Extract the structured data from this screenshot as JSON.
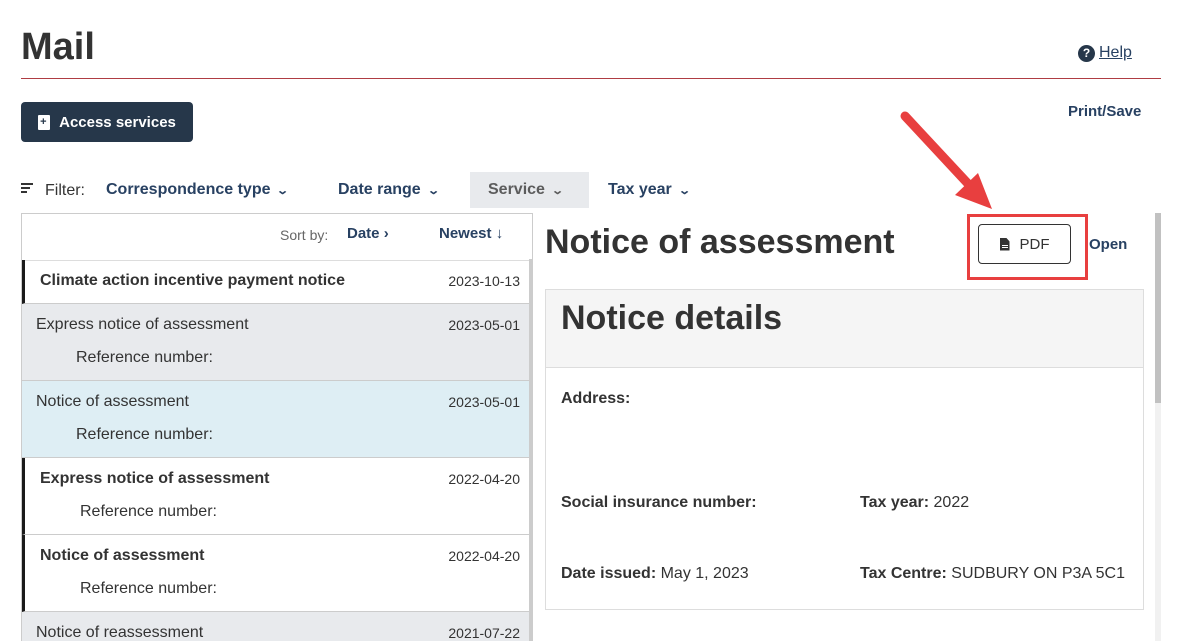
{
  "header": {
    "title": "Mail",
    "help_label": "Help",
    "access_label": "Access services",
    "print_label": "Print/Save"
  },
  "filter": {
    "label": "Filter:",
    "options": [
      "Correspondence type",
      "Date range",
      "Service",
      "Tax year"
    ],
    "active": "Service"
  },
  "sort": {
    "label": "Sort by:",
    "field": "Date",
    "order": "Newest"
  },
  "mail_list": [
    {
      "name": "Climate action incentive payment notice",
      "date": "2023-10-13",
      "ref_label": "",
      "unread": true,
      "state": "normal"
    },
    {
      "name": "Express notice of assessment",
      "date": "2023-05-01",
      "ref_label": "Reference number:",
      "unread": false,
      "state": "grey"
    },
    {
      "name": "Notice of assessment",
      "date": "2023-05-01",
      "ref_label": "Reference number:",
      "unread": false,
      "state": "selected"
    },
    {
      "name": "Express notice of assessment",
      "date": "2022-04-20",
      "ref_label": "Reference number:",
      "unread": true,
      "state": "normal"
    },
    {
      "name": "Notice of assessment",
      "date": "2022-04-20",
      "ref_label": "Reference number:",
      "unread": true,
      "state": "normal"
    },
    {
      "name": "Notice of reassessment",
      "date": "2021-07-22",
      "ref_label": "",
      "unread": false,
      "state": "grey"
    }
  ],
  "detail": {
    "title": "Notice of assessment",
    "pdf_label": "PDF",
    "open_label": "Open",
    "details_heading": "Notice details",
    "address_label": "Address:",
    "sin_label": "Social insurance number:",
    "tax_year_label": "Tax year:",
    "tax_year_value": "2022",
    "date_issued_label": "Date issued:",
    "date_issued_value": "May 1, 2023",
    "tax_centre_label": "Tax Centre:",
    "tax_centre_value": "SUDBURY ON P3A 5C1"
  },
  "colors": {
    "primary": "#26374a",
    "link": "#284162",
    "rule": "#af3c43",
    "selected_row": "#deeef4",
    "grey_row": "#e8eaed",
    "annotation": "#e83f3f"
  },
  "icons": {
    "help": "question-circle-icon",
    "access": "document-plus-icon",
    "filter": "filter-lines-icon",
    "pdf": "document-icon",
    "annotation": "red-arrow-icon"
  }
}
